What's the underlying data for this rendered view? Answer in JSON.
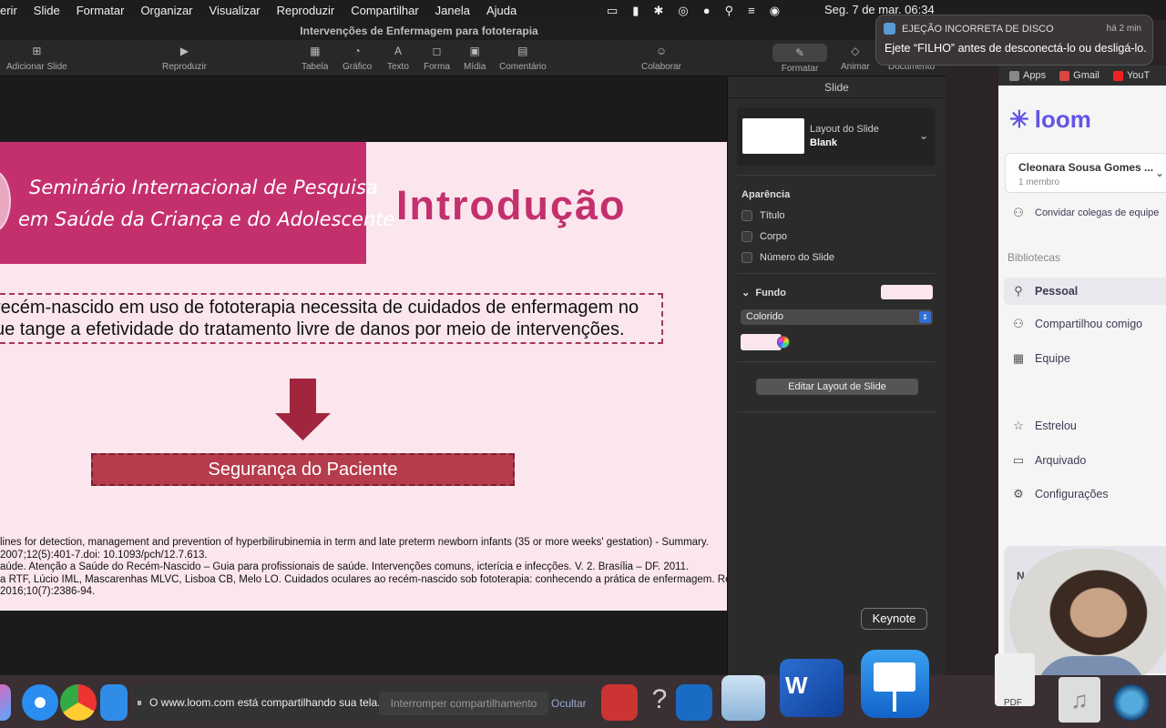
{
  "menubar": {
    "items": [
      "erir",
      "Slide",
      "Formatar",
      "Organizar",
      "Visualizar",
      "Reproduzir",
      "Compartilhar",
      "Janela",
      "Ajuda"
    ],
    "clock": "Seg. 7 de mar.  06:34"
  },
  "window": {
    "title": "Intervenções de Enfermagem para fototerapia"
  },
  "toolbar": {
    "add_slide": "Adicionar Slide",
    "play": "Reproduzir",
    "table": "Tabela",
    "chart": "Gráfico",
    "text": "Texto",
    "shape": "Forma",
    "media": "Mídia",
    "comment": "Comentário",
    "collaborate": "Colaborar",
    "format": "Formatar",
    "animate": "Animar",
    "document": "Documento"
  },
  "slide": {
    "seminar_line1": "Seminário Internacional de Pesquisa",
    "seminar_line2": "em Saúde da Criança e do Adolescente",
    "title": "Introdução",
    "body_line1": "recém-nascido em uso de fototerapia necessita de cuidados de enfermagem no",
    "body_line2": "ue tange a efetividade do tratamento livre de danos por meio de intervenções.",
    "safety": "Segurança do Paciente",
    "refs": [
      "lines for detection, management and prevention of hyperbilirubinemia in term and late preterm newborn infants (35 or more weeks' gestation) - Summary.",
      "2007;12(5):401-7.doi: 10.1093/pch/12.7.613.",
      "aúde. Atenção a Saúde do Recém-Nascido – Guia para profissionais de saúde. Intervenções comuns, icterícia e infecções. V. 2. Brasília – DF. 2011.",
      "a RTF, Lúcio IML, Mascarenhas MLVC, Lisboa CB, Melo LO. Cuidados oculares ao recém-nascido sob fototerapia: conhecendo a prática de enfermagem. Rev",
      "2016;10(7):2386-94."
    ]
  },
  "inspector": {
    "header": "Slide",
    "layout_label": "Layout do Slide",
    "layout_value": "Blank",
    "appearance": "Aparência",
    "title_cb": "Título",
    "body_cb": "Corpo",
    "number_cb": "Número do Slide",
    "background": "Fundo",
    "fill_type": "Colorido",
    "edit_layout": "Editar Layout de Slide",
    "bg_color": "#fbe6ee"
  },
  "notification": {
    "title": "EJEÇÃO INCORRETA DE DISCO",
    "time": "há 2 min",
    "message": "Ejete “FILHO” antes de desconectá-lo ou desligá-lo."
  },
  "loom": {
    "bookmarks": [
      "Apps",
      "Gmail",
      "YouT"
    ],
    "brand": "loom",
    "workspace": "Cleonara Sousa Gomes ...",
    "members": "1 membro",
    "invite": "Convidar colegas de equipe",
    "libraries": "Bibliotecas",
    "nav": [
      "Pessoal",
      "Compartilhou comigo",
      "Equipe",
      "Estrelou",
      "Arquivado",
      "Configurações"
    ],
    "card_text": "N"
  },
  "tooltip": "Keynote",
  "sharebar": {
    "message": "O www.loom.com está compartilhando sua tela.",
    "stop": "Interromper compartilhamento",
    "hide": "Ocultar"
  },
  "dock": {
    "word_letter": "W",
    "pdf_label": "PDF"
  }
}
